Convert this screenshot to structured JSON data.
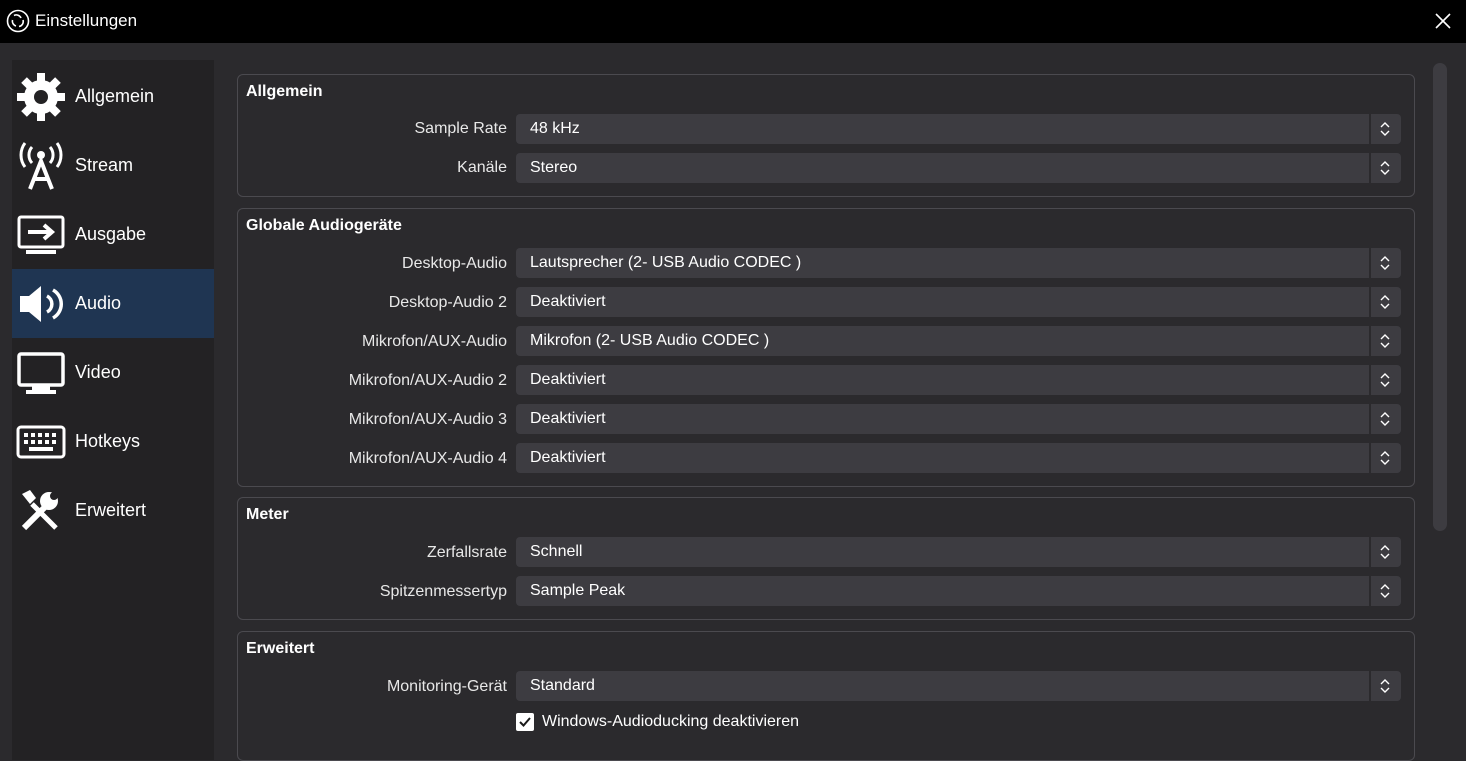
{
  "window": {
    "title": "Einstellungen",
    "close_icon": "close-icon"
  },
  "sidebar": {
    "items": [
      {
        "label": "Allgemein",
        "icon": "gear-icon"
      },
      {
        "label": "Stream",
        "icon": "broadcast-antenna-icon"
      },
      {
        "label": "Ausgabe",
        "icon": "output-monitor-icon"
      },
      {
        "label": "Audio",
        "icon": "speaker-icon",
        "active": true
      },
      {
        "label": "Video",
        "icon": "monitor-icon"
      },
      {
        "label": "Hotkeys",
        "icon": "keyboard-icon"
      },
      {
        "label": "Erweitert",
        "icon": "tools-icon"
      }
    ]
  },
  "groups": {
    "allgemein": {
      "title": "Allgemein",
      "rows": [
        {
          "label": "Sample Rate",
          "value": "48 kHz"
        },
        {
          "label": "Kanäle",
          "value": "Stereo"
        }
      ]
    },
    "globale": {
      "title": "Globale Audiogeräte",
      "rows": [
        {
          "label": "Desktop-Audio",
          "value": "Lautsprecher (2- USB Audio CODEC )"
        },
        {
          "label": "Desktop-Audio 2",
          "value": "Deaktiviert"
        },
        {
          "label": "Mikrofon/AUX-Audio",
          "value": "Mikrofon (2- USB Audio CODEC )"
        },
        {
          "label": "Mikrofon/AUX-Audio 2",
          "value": "Deaktiviert"
        },
        {
          "label": "Mikrofon/AUX-Audio 3",
          "value": "Deaktiviert"
        },
        {
          "label": "Mikrofon/AUX-Audio 4",
          "value": "Deaktiviert"
        }
      ]
    },
    "meter": {
      "title": "Meter",
      "rows": [
        {
          "label": "Zerfallsrate",
          "value": "Schnell"
        },
        {
          "label": "Spitzenmessertyp",
          "value": "Sample Peak"
        }
      ]
    },
    "erweitert": {
      "title": "Erweitert",
      "rows": [
        {
          "label": "Monitoring-Gerät",
          "value": "Standard"
        }
      ],
      "checkbox": {
        "label": "Windows-Audioducking deaktivieren",
        "checked": true
      }
    }
  },
  "colors": {
    "background": "#2b2a2d",
    "titlebar": "#000000",
    "sidebar": "#232224",
    "sidebar_active": "#1f3552",
    "control": "#3d3c41",
    "border": "#4b4a4f"
  }
}
